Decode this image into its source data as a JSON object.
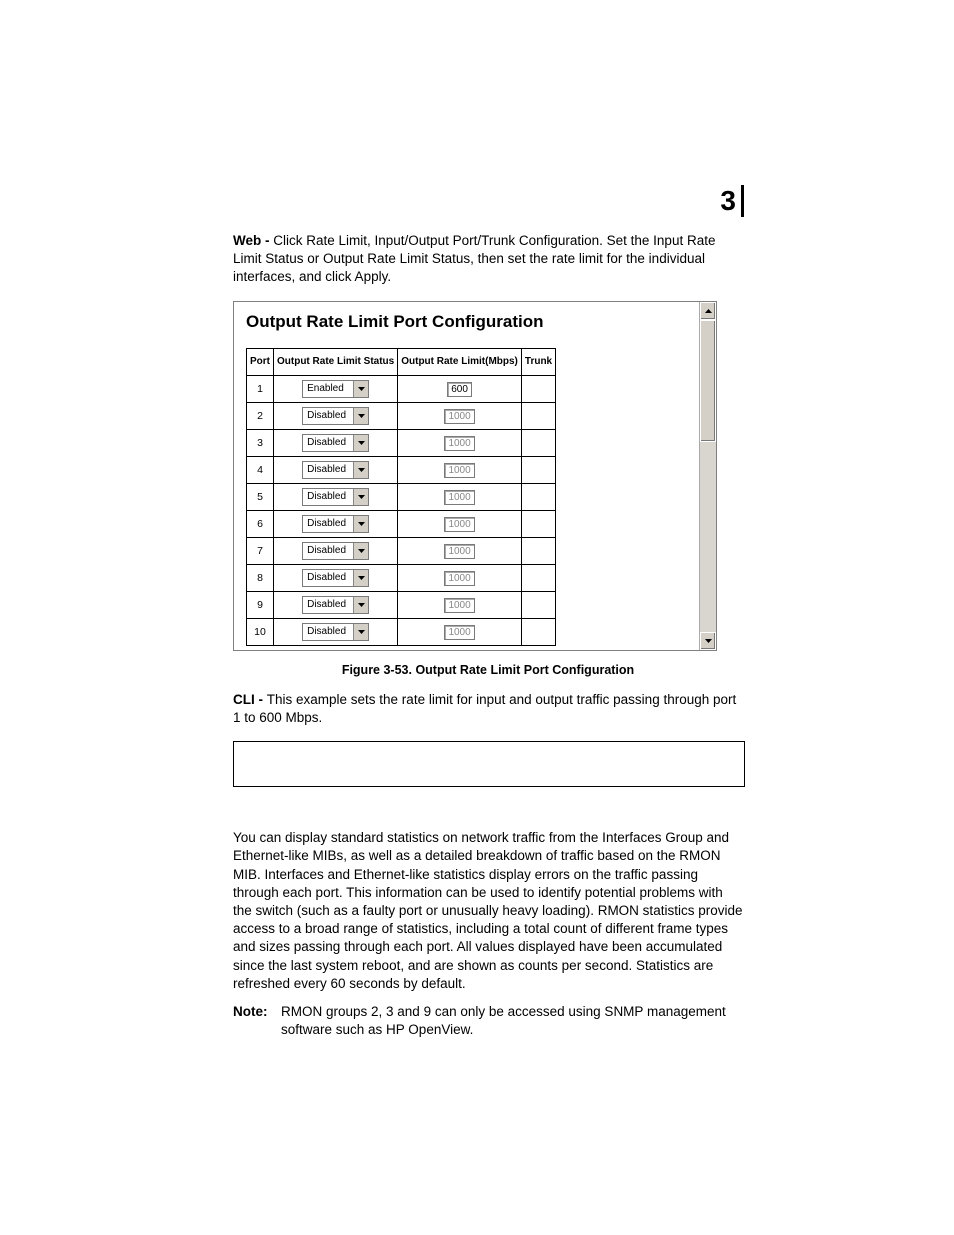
{
  "chapter": "3",
  "intro": {
    "label": "Web - ",
    "text": "Click Rate Limit, Input/Output Port/Trunk Configuration. Set the Input Rate Limit Status or Output Rate Limit Status, then set the rate limit for the individual interfaces, and click Apply."
  },
  "panel": {
    "title": "Output Rate Limit Port Configuration",
    "headers": [
      "Port",
      "Output Rate Limit Status",
      "Output Rate Limit(Mbps)",
      "Trunk"
    ],
    "rows": [
      {
        "port": "1",
        "status": "Enabled",
        "limit": "600",
        "enabled": true
      },
      {
        "port": "2",
        "status": "Disabled",
        "limit": "1000",
        "enabled": false
      },
      {
        "port": "3",
        "status": "Disabled",
        "limit": "1000",
        "enabled": false
      },
      {
        "port": "4",
        "status": "Disabled",
        "limit": "1000",
        "enabled": false
      },
      {
        "port": "5",
        "status": "Disabled",
        "limit": "1000",
        "enabled": false
      },
      {
        "port": "6",
        "status": "Disabled",
        "limit": "1000",
        "enabled": false
      },
      {
        "port": "7",
        "status": "Disabled",
        "limit": "1000",
        "enabled": false
      },
      {
        "port": "8",
        "status": "Disabled",
        "limit": "1000",
        "enabled": false
      },
      {
        "port": "9",
        "status": "Disabled",
        "limit": "1000",
        "enabled": false
      },
      {
        "port": "10",
        "status": "Disabled",
        "limit": "1000",
        "enabled": false
      }
    ]
  },
  "figure_caption": "Figure 3-53.  Output Rate Limit Port Configuration",
  "cli": {
    "label": "CLI - ",
    "text": "This example sets the rate limit for input and output traffic passing through port 1 to 600 Mbps."
  },
  "stats_para": "You can display standard statistics on network traffic from the Interfaces Group and Ethernet-like MIBs, as well as a detailed breakdown of traffic based on the RMON MIB. Interfaces and Ethernet-like statistics display errors on the traffic passing through each port. This information can be used to identify potential problems with the switch (such as a faulty port or unusually heavy loading). RMON statistics provide access to a broad range of statistics, including a total count of different frame types and sizes passing through each port. All values displayed have been accumulated since the last system reboot, and are shown as counts per second. Statistics are refreshed every 60 seconds by default.",
  "note": {
    "label": "Note:",
    "text": "RMON groups 2, 3 and 9 can only be accessed using SNMP management software such as HP OpenView."
  }
}
